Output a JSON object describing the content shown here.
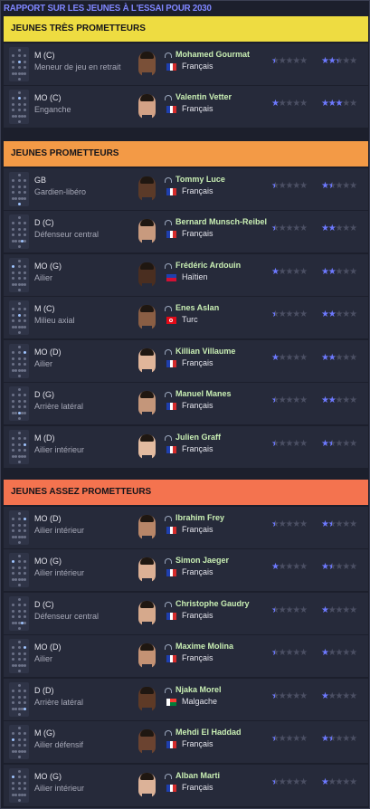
{
  "title": "RAPPORT SUR LES JEUNES À L'ESSAI POUR 2030",
  "colors": {
    "accent": "#7f86ff",
    "star": "#6d79ff",
    "name": "#c9efb4",
    "section_1": "#eedc41",
    "section_2": "#f39a46",
    "section_3": "#f4734f"
  },
  "sections": [
    {
      "title": "JEUNES TRÈS PROMETTEURS",
      "color": "#eedc41",
      "rows": [
        {
          "pos": "M (C)",
          "role": "Meneur de jeu en retrait",
          "name": "Mohamed Gourmat",
          "nat": "Français",
          "flag": "fr",
          "skin": "#7a5038",
          "ca": 0.5,
          "pa": 2.5
        },
        {
          "pos": "MO (C)",
          "role": "Enganche",
          "name": "Valentin Vetter",
          "nat": "Français",
          "flag": "fr",
          "skin": "#d3a286",
          "ca": 1,
          "pa": 3
        }
      ]
    },
    {
      "title": "JEUNES PROMETTEURS",
      "color": "#f39a46",
      "rows": [
        {
          "pos": "GB",
          "role": "Gardien-libéro",
          "name": "Tommy Luce",
          "nat": "Français",
          "flag": "fr",
          "skin": "#5b3a28",
          "ca": 0.5,
          "pa": 1.5
        },
        {
          "pos": "D (C)",
          "role": "Défenseur central",
          "name": "Bernard Munsch-Reibel",
          "nat": "Français",
          "flag": "fr",
          "skin": "#c89a7e",
          "ca": 0.5,
          "pa": 2
        },
        {
          "pos": "MO (G)",
          "role": "Ailier",
          "name": "Frédéric Ardouin",
          "nat": "Haïtien",
          "flag": "ht",
          "skin": "#4a2e20",
          "ca": 1,
          "pa": 2
        },
        {
          "pos": "M (C)",
          "role": "Milieu axial",
          "name": "Enes Aslan",
          "nat": "Turc",
          "flag": "tr",
          "skin": "#8a5e44",
          "ca": 0.5,
          "pa": 2
        },
        {
          "pos": "MO (D)",
          "role": "Ailier",
          "name": "Killian Villaume",
          "nat": "Français",
          "flag": "fr",
          "skin": "#e0b59a",
          "ca": 1,
          "pa": 2
        },
        {
          "pos": "D (G)",
          "role": "Arrière latéral",
          "name": "Manuel Manes",
          "nat": "Français",
          "flag": "fr",
          "skin": "#c4967a",
          "ca": 0.5,
          "pa": 2
        },
        {
          "pos": "M (D)",
          "role": "Ailier intérieur",
          "name": "Julien Graff",
          "nat": "Français",
          "flag": "fr",
          "skin": "#e3bba0",
          "ca": 0.5,
          "pa": 1.5
        }
      ]
    },
    {
      "title": "JEUNES ASSEZ PROMETTEURS",
      "color": "#f4734f",
      "rows": [
        {
          "pos": "MO (D)",
          "role": "Ailier intérieur",
          "name": "Ibrahim Frey",
          "nat": "Français",
          "flag": "fr",
          "skin": "#b88668",
          "ca": 0.5,
          "pa": 1.5
        },
        {
          "pos": "MO (G)",
          "role": "Ailier intérieur",
          "name": "Simon Jaeger",
          "nat": "Français",
          "flag": "fr",
          "skin": "#dcb095",
          "ca": 1,
          "pa": 1.5
        },
        {
          "pos": "D (C)",
          "role": "Défenseur central",
          "name": "Christophe Gaudry",
          "nat": "Français",
          "flag": "fr",
          "skin": "#d6a98c",
          "ca": 0.5,
          "pa": 1
        },
        {
          "pos": "MO (D)",
          "role": "Ailier",
          "name": "Maxime Molina",
          "nat": "Français",
          "flag": "fr",
          "skin": "#c49274",
          "ca": 0.5,
          "pa": 1
        },
        {
          "pos": "D (D)",
          "role": "Arrière latéral",
          "name": "Njaka Morel",
          "nat": "Malgache",
          "flag": "mg",
          "skin": "#5e3a26",
          "ca": 0.5,
          "pa": 1
        },
        {
          "pos": "M (G)",
          "role": "Ailier défensif",
          "name": "Mehdi El Haddad",
          "nat": "Français",
          "flag": "fr",
          "skin": "#6b4330",
          "ca": 0.5,
          "pa": 1.5
        },
        {
          "pos": "MO (G)",
          "role": "Ailier intérieur",
          "name": "Alban Marti",
          "nat": "Français",
          "flag": "fr",
          "skin": "#dcb298",
          "ca": 0.5,
          "pa": 1
        }
      ]
    }
  ]
}
